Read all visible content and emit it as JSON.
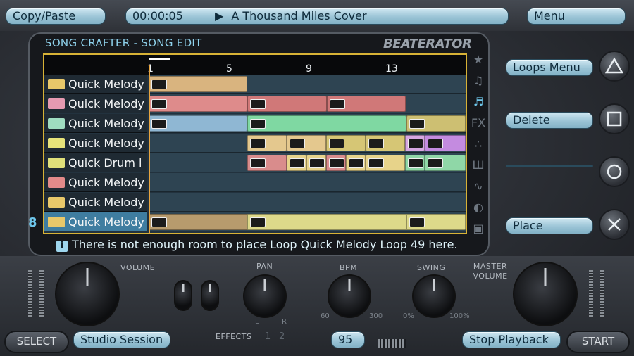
{
  "top": {
    "copy_paste": "Copy/Paste",
    "time": "00:00:05",
    "song": "A Thousand Miles Cover",
    "menu": "Menu"
  },
  "panel": {
    "title": "SONG CRAFTER - SONG EDIT",
    "logo": "BEATERATOR"
  },
  "ruler": [
    "1",
    "5",
    "9",
    "13"
  ],
  "tracks": [
    {
      "name": "Quick Melody",
      "icon_color": "#e8c86a"
    },
    {
      "name": "Quick Melody",
      "icon_color": "#e59ab1"
    },
    {
      "name": "Quick Melody",
      "icon_color": "#9fdcc0"
    },
    {
      "name": "Quick Melody",
      "icon_color": "#e6e37a"
    },
    {
      "name": "Quick Drum l",
      "icon_color": "#dfe07a"
    },
    {
      "name": "Quick Melody",
      "icon_color": "#e28a8a"
    },
    {
      "name": "Quick Melody",
      "icon_color": "#e8c86a"
    },
    {
      "name": "Quick Melody",
      "icon_color": "#e8c86a"
    }
  ],
  "side": {
    "loops_menu": "Loops Menu",
    "delete": "Delete",
    "place": "Place",
    "empty": ""
  },
  "message": "There is not enough room to place Loop Quick Melody Loop 49 here.",
  "controls": {
    "volume": "VOLUME",
    "pan": "PAN",
    "bpm": "BPM",
    "swing": "SWING",
    "master_volume": "MASTER VOLUME",
    "effects": "EFFECTS",
    "effects_1": "1",
    "effects_2": "2",
    "bpm_min": "60",
    "bpm_max": "300",
    "swing_min": "0%",
    "swing_max": "100%",
    "pan_l": "L",
    "pan_r": "R"
  },
  "bottom": {
    "select": "SELECT",
    "studio_session": "Studio Session",
    "bpm_value": "95",
    "stop_playback": "Stop Playback",
    "start": "START"
  },
  "track_number": "8"
}
